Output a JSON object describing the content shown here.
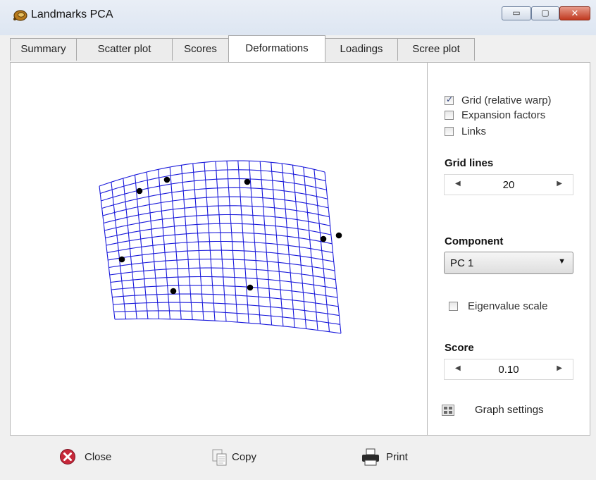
{
  "window": {
    "title": "Landmarks PCA",
    "minimize_glyph": "▭",
    "maximize_glyph": "▢",
    "close_glyph": "✕"
  },
  "tabs": [
    {
      "label": "Summary",
      "active": false
    },
    {
      "label": "Scatter plot",
      "active": false
    },
    {
      "label": "Scores",
      "active": false
    },
    {
      "label": "Deformations",
      "active": true
    },
    {
      "label": "Loadings",
      "active": false
    },
    {
      "label": "Scree plot",
      "active": false
    }
  ],
  "options": {
    "grid": {
      "label": "Grid (relative warp)",
      "checked": true
    },
    "expansion": {
      "label": "Expansion factors",
      "checked": false
    },
    "links": {
      "label": "Links",
      "checked": false
    }
  },
  "grid_lines": {
    "label": "Grid lines",
    "value": "20"
  },
  "component": {
    "label": "Component",
    "value": "PC 1"
  },
  "eigenvalue": {
    "label": "Eigenvalue scale",
    "checked": false
  },
  "score": {
    "label": "Score",
    "value": "0.10"
  },
  "graph_settings": {
    "label": "Graph settings",
    "icon": "grid-settings-icon"
  },
  "bottom": {
    "close": {
      "label": "Close",
      "icon": "close-circle-icon"
    },
    "copy": {
      "label": "Copy",
      "icon": "copy-icon"
    },
    "print": {
      "label": "Print",
      "icon": "printer-icon"
    }
  },
  "deformation": {
    "grid_color": "#1a1adb",
    "landmark_color": "#000000"
  }
}
